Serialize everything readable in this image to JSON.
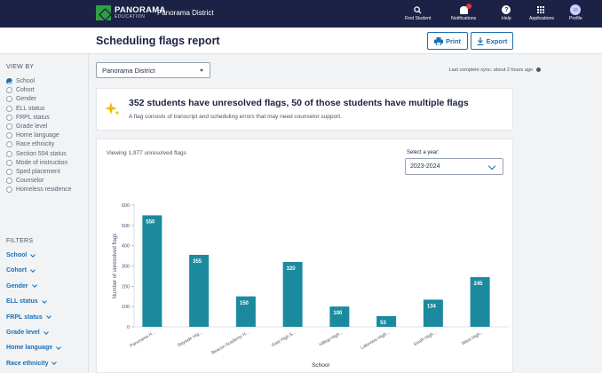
{
  "topbar": {
    "logo_main": "PANORAMA",
    "logo_sub": "EDUCATION",
    "district": "Panorama District",
    "nav": [
      {
        "label": "Find Student",
        "icon": "search-icon"
      },
      {
        "label": "Notifications",
        "icon": "bell-icon"
      },
      {
        "label": "Help",
        "icon": "help-icon"
      },
      {
        "label": "Applications",
        "icon": "grid-icon"
      },
      {
        "label": "Profile",
        "icon": "profile-icon"
      }
    ]
  },
  "header": {
    "title": "Scheduling flags report",
    "print_label": "Print",
    "export_label": "Export"
  },
  "sidebar": {
    "view_by_heading": "VIEW BY",
    "view_by": [
      {
        "label": "School",
        "checked": true
      },
      {
        "label": "Cohort",
        "checked": false
      },
      {
        "label": "Gender",
        "checked": false
      },
      {
        "label": "ELL status",
        "checked": false
      },
      {
        "label": "FRPL status",
        "checked": false
      },
      {
        "label": "Grade level",
        "checked": false
      },
      {
        "label": "Home language",
        "checked": false
      },
      {
        "label": "Race ethnicity",
        "checked": false
      },
      {
        "label": "Section 504 status",
        "checked": false
      },
      {
        "label": "Mode of instruction",
        "checked": false
      },
      {
        "label": "Sped placement",
        "checked": false
      },
      {
        "label": "Counselor",
        "checked": false
      },
      {
        "label": "Homeless residence",
        "checked": false
      }
    ],
    "filters_heading": "FILTERS",
    "filters": [
      "School",
      "Cohort",
      "Gender",
      "ELL status",
      "FRPL status",
      "Grade level",
      "Home language",
      "Race ethnicity"
    ]
  },
  "main": {
    "district_select": "Panorama District",
    "sync_text": "Last complete sync: about 2 hours ago",
    "banner_title": "352 students have unresolved flags, 50 of those students have multiple flags",
    "banner_subtitle": "A flag consists of transcript and scheduling errors that may need counselor support.",
    "viewing_text": "Viewing 1,977 unresolved flags",
    "year_label": "Select a year:",
    "year_value": "2023-2024"
  },
  "colors": {
    "nav_bg": "#1c2246",
    "accent": "#1a6fb5",
    "bar": "#1b8a9e",
    "sparkle": "#f5b700"
  },
  "chart_data": {
    "type": "bar",
    "categories": [
      "Panorama H...",
      "Bayside Hig...",
      "Beacon Academy H...",
      "East High S...",
      "Hilltop High...",
      "Lakeview High...",
      "South High...",
      "West High..."
    ],
    "values": [
      550,
      355,
      150,
      320,
      100,
      53,
      134,
      245
    ],
    "xlabel": "School",
    "ylabel": "Number of unresolved flags",
    "ylim": [
      0,
      600
    ],
    "yticks": [
      0,
      100,
      200,
      300,
      400,
      500,
      600
    ],
    "grid": false,
    "data_labels": true
  }
}
